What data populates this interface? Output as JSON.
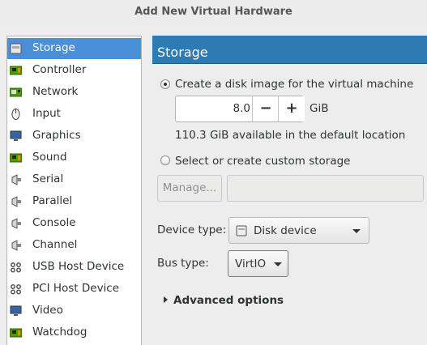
{
  "window": {
    "title": "Add New Virtual Hardware"
  },
  "sidebar": {
    "items": [
      {
        "label": "Storage",
        "icon": "storage-icon",
        "selected": true
      },
      {
        "label": "Controller",
        "icon": "controller-icon"
      },
      {
        "label": "Network",
        "icon": "network-icon"
      },
      {
        "label": "Input",
        "icon": "mouse-icon"
      },
      {
        "label": "Graphics",
        "icon": "monitor-icon"
      },
      {
        "label": "Sound",
        "icon": "sound-card-icon"
      },
      {
        "label": "Serial",
        "icon": "serial-plug-icon"
      },
      {
        "label": "Parallel",
        "icon": "parallel-plug-icon"
      },
      {
        "label": "Console",
        "icon": "console-plug-icon"
      },
      {
        "label": "Channel",
        "icon": "channel-plug-icon"
      },
      {
        "label": "USB Host Device",
        "icon": "usb-icon"
      },
      {
        "label": "PCI Host Device",
        "icon": "pci-icon"
      },
      {
        "label": "Video",
        "icon": "video-monitor-icon"
      },
      {
        "label": "Watchdog",
        "icon": "watchdog-chip-icon"
      }
    ]
  },
  "panel": {
    "header": "Storage",
    "create_disk": {
      "label": "Create a disk image for the virtual machine",
      "checked": true,
      "size_value": "8.0",
      "decrement": "−",
      "increment": "+",
      "unit": "GiB",
      "available": "110.3 GiB available in the default location"
    },
    "custom_storage": {
      "label": "Select or create custom storage",
      "checked": false,
      "manage_button": "Manage...",
      "path_value": ""
    },
    "device_type": {
      "label": "Device type:",
      "value": "Disk device",
      "icon": "disk-device-icon"
    },
    "bus_type": {
      "label": "Bus type:",
      "value": "VirtIO"
    },
    "advanced": {
      "label": "Advanced options",
      "expanded": false
    }
  },
  "colors": {
    "header_bg": "#2e7ab3",
    "selection_bg": "#4a90d9"
  }
}
